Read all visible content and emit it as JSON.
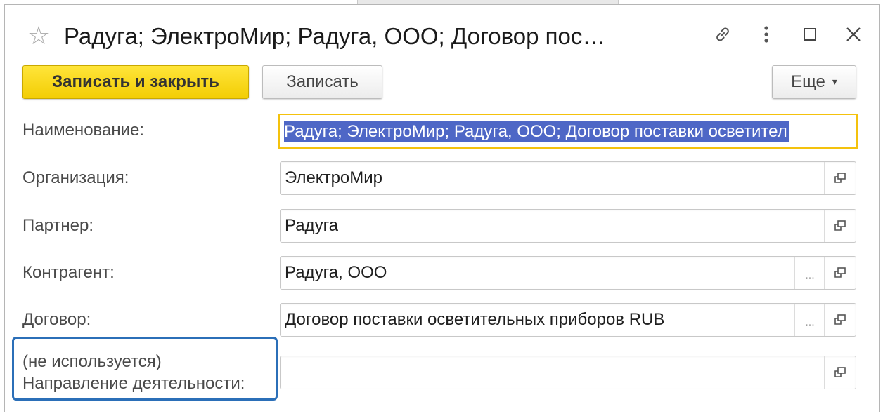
{
  "window": {
    "title": "Радуга; ЭлектроМир; Радуга, ООО; Договор пос…"
  },
  "icons": {
    "favorite": "star-icon",
    "link": "link-icon",
    "menu": "more-vertical-icon",
    "maximize": "maximize-icon",
    "close": "close-icon",
    "open": "open-in-new-window-icon",
    "select": "ellipsis-icon"
  },
  "toolbar": {
    "save_close_label": "Записать и закрыть",
    "save_label": "Записать",
    "more_label": "Еще",
    "more_caret": "▾"
  },
  "form": {
    "name": {
      "label": "Наименование:",
      "value": "Радуга; ЭлектроМир; Радуга, ООО; Договор поставки осветител"
    },
    "organization": {
      "label": "Организация:",
      "value": "ЭлектроМир"
    },
    "partner": {
      "label": "Партнер:",
      "value": "Радуга"
    },
    "counterparty": {
      "label": "Контрагент:",
      "value": "Радуга, ООО",
      "select_label": "..."
    },
    "contract": {
      "label": "Договор:",
      "value": "Договор поставки осветительных приборов RUB",
      "select_label": "..."
    },
    "activity_direction": {
      "label_line1": "(не используется)",
      "label_line2": "Направление деятельности:",
      "value": ""
    }
  },
  "colors": {
    "primary_button": "#f5d20a",
    "focus_border": "#f4c20d",
    "selection": "#4e67c6",
    "highlight_frame": "#2b6fb8"
  }
}
